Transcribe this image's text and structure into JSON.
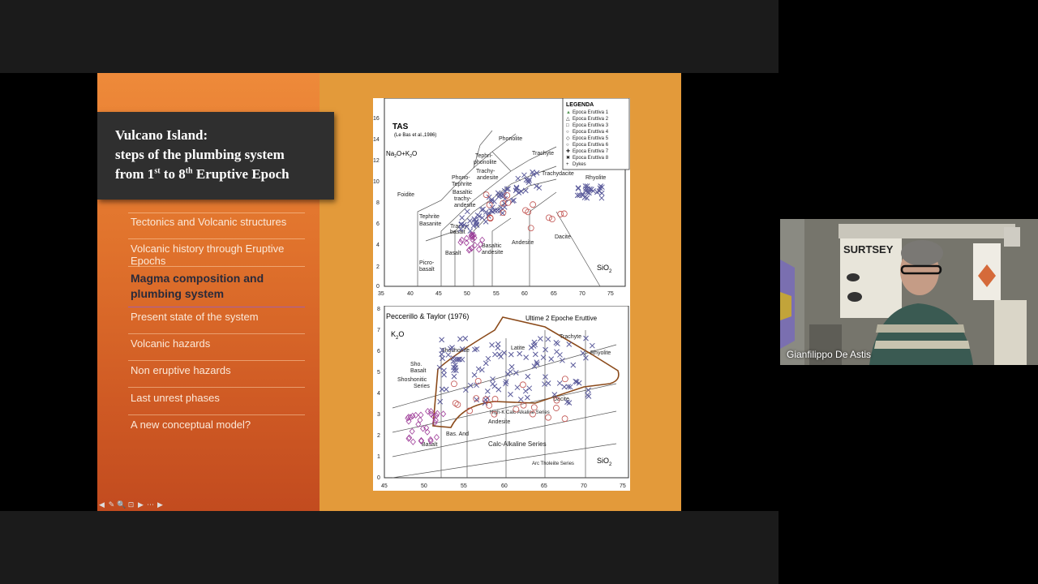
{
  "slide": {
    "title_line1": "Vulcano Island:",
    "title_line2": "steps of the plumbing system",
    "title_line3_parts": [
      "from 1",
      "st",
      " to 8",
      "th",
      " Eruptive Epoch"
    ],
    "menu": [
      {
        "label": "Tectonics and Volcanic structures",
        "active": false
      },
      {
        "label": "Volcanic history through Eruptive Epochs",
        "active": false
      },
      {
        "label": "Magma composition and plumbing system",
        "active": true
      },
      {
        "label": "Present state of the system",
        "active": false
      },
      {
        "label": "Volcanic hazards",
        "active": false
      },
      {
        "label": "Non eruptive hazards",
        "active": false
      },
      {
        "label": "Last unrest phases",
        "active": false
      },
      {
        "label": "A new conceptual model?",
        "active": false
      }
    ]
  },
  "tas": {
    "title": "TAS",
    "subtitle": "(Le Bas et al.,1986)",
    "ylabel_main": "Na",
    "ylabel_sub1": "2",
    "ylabel_mid": "O+K",
    "ylabel_sub2": "2",
    "ylabel_end": "O",
    "xlabel_main": "SiO",
    "xlabel_sub": "2",
    "x_ticks": [
      "35",
      "40",
      "45",
      "50",
      "55",
      "60",
      "65",
      "70",
      "75"
    ],
    "y_ticks": [
      "0",
      "2",
      "4",
      "6",
      "8",
      "10",
      "12",
      "14",
      "16"
    ],
    "fields": [
      "Foidite",
      "Phonolite",
      "Tephri-",
      "phonolite",
      "Trachyte",
      "Trachydacite",
      "Rhyolite",
      "Phono-",
      "Tephrite",
      "Trachy-",
      "andesite",
      "Basaltic",
      "trachy-",
      "andesite",
      "Tephrite",
      "Basanite",
      "Trachy-",
      "basalt",
      "Basalt",
      "Picro-",
      "basalt",
      "Basaltic",
      "andesite",
      "Andesite",
      "Dacite"
    ]
  },
  "legend": {
    "title": "LEGENDA",
    "items": [
      {
        "symbol": "▲",
        "label": "Epoca Eruttiva 1"
      },
      {
        "symbol": "△",
        "label": "Epoca Eruttiva 2"
      },
      {
        "symbol": "□",
        "label": "Epoca Eruttiva 3"
      },
      {
        "symbol": "○",
        "label": "Epoca Eruttiva 4"
      },
      {
        "symbol": "◇",
        "label": "Epoca Eruttiva 5"
      },
      {
        "symbol": "○",
        "label": "Epoca Eruttiva 6"
      },
      {
        "symbol": "✚",
        "label": "Epoca Eruttiva 7"
      },
      {
        "symbol": "✖",
        "label": "Epoca Eruttiva 8"
      },
      {
        "symbol": "+",
        "label": "Dykes"
      }
    ]
  },
  "k2o": {
    "title": "Peccerillo & Taylor (1976)",
    "annotation": "Ultime 2 Epoche Eruttive",
    "ylabel_main": "K",
    "ylabel_sub": "2",
    "ylabel_end": "O",
    "xlabel_main": "SiO",
    "xlabel_sub": "2",
    "x_ticks": [
      "45",
      "50",
      "55",
      "60",
      "65",
      "70",
      "75"
    ],
    "y_ticks": [
      "0",
      "1",
      "2",
      "3",
      "4",
      "5",
      "6",
      "7",
      "8"
    ],
    "fields": [
      "Shoshonite",
      "Latite",
      "Trachyte",
      "Rhyolite",
      "Sho.",
      "Basalt",
      "Shoshonitic",
      "Series",
      "Dacite",
      "High-K Calc-Alkaline Series",
      "Andesite",
      "Bas. And",
      "Basalt",
      "Calc-Alkaline Series",
      "Arc Tholeiite Series"
    ]
  },
  "colors": {
    "slide_bg": "#e39a3a",
    "title_box": "#2f2f2f",
    "cross_symbols": "#5a5a9a",
    "circle_symbols": "#c0504d",
    "diamond_symbols": "#a0409a",
    "outline": "#8b4a1a"
  },
  "participant": {
    "name": "Gianfilippo De Astis",
    "poster_text": "SURTSEY"
  },
  "controls": [
    "◀",
    "✎",
    "🔍",
    "⊡",
    "▶",
    "⋯",
    "▶"
  ]
}
